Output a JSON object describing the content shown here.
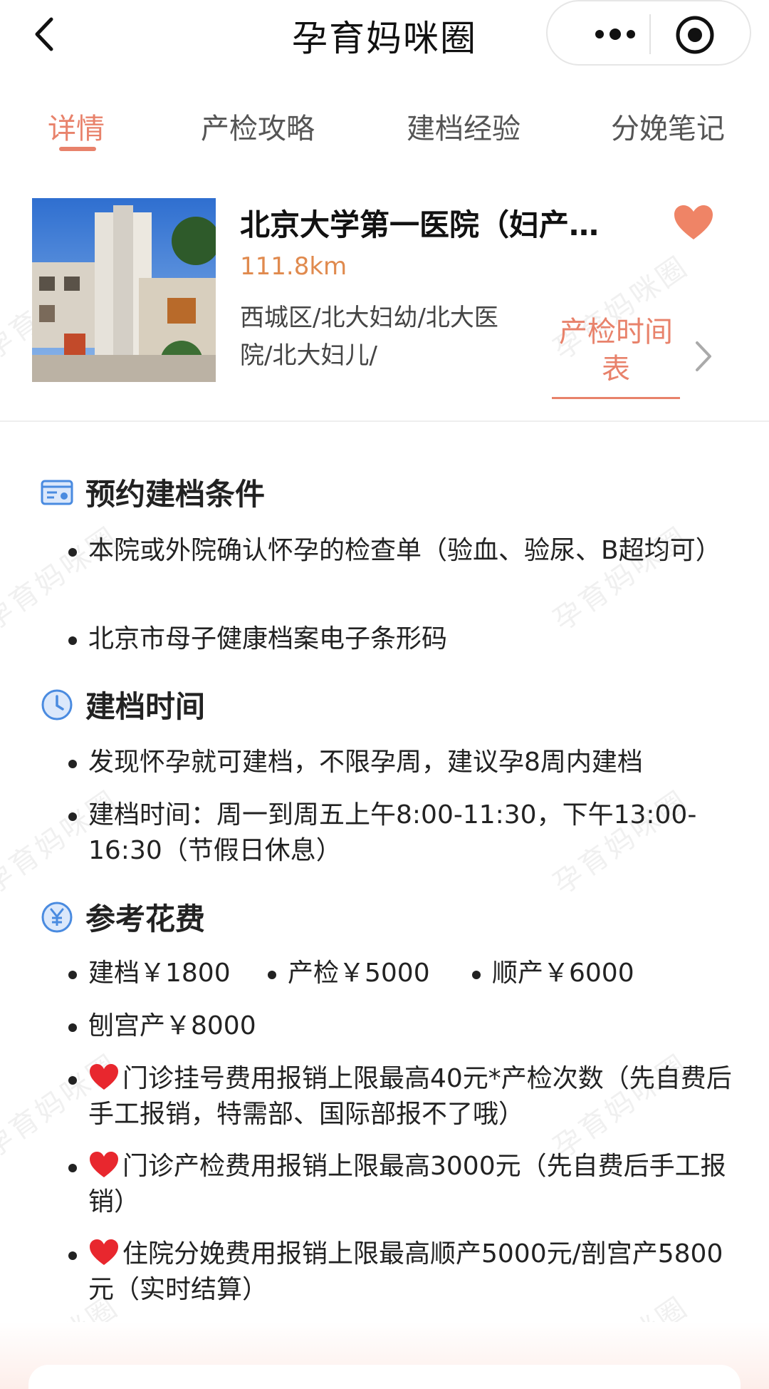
{
  "navbar": {
    "title": "孕育妈咪圈",
    "back_icon": "chevron-left-icon",
    "more_icon": "more-dots-icon",
    "close_icon": "target-circle-icon"
  },
  "tabs": [
    {
      "label": "详情",
      "active": true
    },
    {
      "label": "产检攻略",
      "active": false
    },
    {
      "label": "建档经验",
      "active": false
    },
    {
      "label": "分娩笔记",
      "active": false
    }
  ],
  "hospital": {
    "name": "北京大学第一医院（妇产…",
    "distance": "111.8km",
    "tags": "西城区/北大妇幼/北大医院/北大妇儿/",
    "schedule_button": "产检时间表",
    "favorite_icon": "heart-icon"
  },
  "watermark": "孕育妈咪圈",
  "sections": {
    "conditions": {
      "title": "预约建档条件",
      "icon": "document-card-icon",
      "items": [
        "本院或外院确认怀孕的检查单（验血、验尿、B超均可）",
        "北京市母子健康档案电子条形码"
      ]
    },
    "time": {
      "title": "建档时间",
      "icon": "clock-icon",
      "items": [
        "发现怀孕就可建档，不限孕周，建议孕8周内建档",
        "建档时间：周一到周五上午8:00-11:30，下午13:00-16:30（节假日休息）"
      ]
    },
    "cost": {
      "title": "参考花费",
      "icon": "yen-icon",
      "fees": [
        "建档￥1800",
        "产检￥5000",
        "顺产￥6000",
        "刨宫产￥8000"
      ],
      "reimburse": [
        "门诊挂号费用报销上限最高40元*产检次数（先自费后手工报销，特需部、国际部报不了哦）",
        "门诊产检费用报销上限最高3000元（先自费后手工报销）",
        "住院分娩费用报销上限最高顺产5000元/剖宫产5800元（实时结算）"
      ]
    }
  },
  "colors": {
    "accent": "#e8826b",
    "distance": "#e08a4e",
    "section_icon": "#4a8be0",
    "heart_red": "#e8272e"
  }
}
